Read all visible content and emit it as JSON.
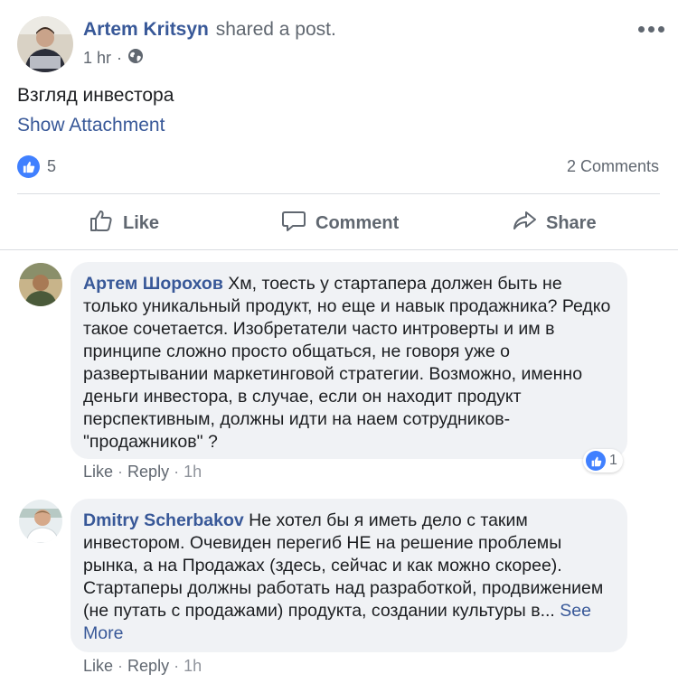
{
  "post": {
    "author": "Artem Kritsyn",
    "action": "shared a post.",
    "time": "1 hr",
    "separator": "·",
    "privacy_icon": "globe-icon",
    "text": "Взгляд инвестора",
    "attachment_link": "Show Attachment",
    "reactions_count": "5",
    "comments_count": "2 Comments"
  },
  "actions": {
    "like": "Like",
    "comment": "Comment",
    "share": "Share"
  },
  "comments": [
    {
      "author": "Артем Шорохов",
      "text": "Хм, тоесть у стартапера должен быть не только уникальный продукт, но еще и навык продажника? Редко такое сочетается. Изобретатели часто интроверты и им в принципе сложно просто общаться, не говоря уже о развертывании маркетинговой стратегии. Возможно, именно деньги инвестора, в случае, если он находит продукт перспективным, должны идти на наем сотрудников-\"продажников\" ?",
      "like": "Like",
      "reply": "Reply",
      "time": "1h",
      "reactions": "1"
    },
    {
      "author": "Dmitry Scherbakov",
      "text": "Не хотел бы я иметь дело с таким инвестором. Очевиден перегиб НЕ на решение проблемы рынка, а на Продажах (здесь, сейчас и как можно скорее). Стартаперы должны работать над разработкой, продвижением (не путать с продажами) продукта, создании культуры в...",
      "see_more": "See More",
      "like": "Like",
      "reply": "Reply",
      "time": "1h"
    }
  ],
  "colors": {
    "link": "#385898",
    "muted": "#606770",
    "bubble": "#f0f2f5",
    "like_blue": "#4080ff",
    "divider": "#dadde1"
  }
}
